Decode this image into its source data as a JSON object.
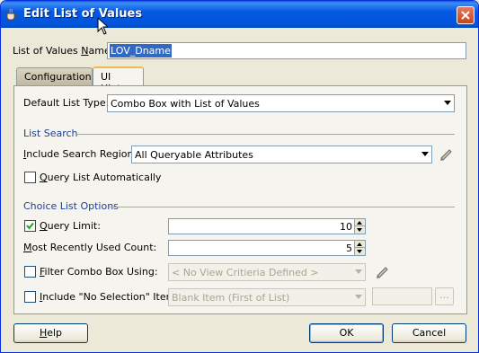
{
  "window": {
    "title": "Edit List of Values",
    "close_glyph": "close-icon"
  },
  "lov_name": {
    "label_pre": "List of Values ",
    "label_u": "N",
    "label_post": "ame:",
    "value": "LOV_Dname"
  },
  "tabs": [
    {
      "label": "Configuration",
      "selected": false
    },
    {
      "label": "UI Hints",
      "selected": true
    }
  ],
  "default_list_type": {
    "label": "Default List Type:",
    "value": "Combo Box with List of Values"
  },
  "list_search": {
    "section": "List Search",
    "include_search_region": {
      "label_u": "I",
      "label_post": "nclude Search Region:",
      "value": "All Queryable Attributes"
    },
    "query_automatically": {
      "label_u": "Q",
      "label_post": "uery List Automatically",
      "checked": false
    }
  },
  "choice_list": {
    "section": "Choice List Options",
    "query_limit": {
      "label_u": "Q",
      "label_post": "uery Limit:",
      "checked": true,
      "value": "10"
    },
    "mru_count": {
      "label_u": "M",
      "label_post": "ost Recently Used Count:",
      "value": "5"
    },
    "filter_combo": {
      "label_u": "F",
      "label_post": "ilter Combo Box Using:",
      "checked": false,
      "value": "< No View Critieria Defined >"
    },
    "no_selection": {
      "label_u": "I",
      "label_post": "nclude \"No Selection\" Item:",
      "checked": false,
      "value": "Blank Item (First of List)",
      "ellipsis": "..."
    }
  },
  "buttons": {
    "help_u": "H",
    "help_post": "elp",
    "ok": "OK",
    "cancel": "Cancel"
  },
  "colors": {
    "titlebar": "#0358e3",
    "section_text": "#1c3f95",
    "selection": "#316ac5"
  }
}
